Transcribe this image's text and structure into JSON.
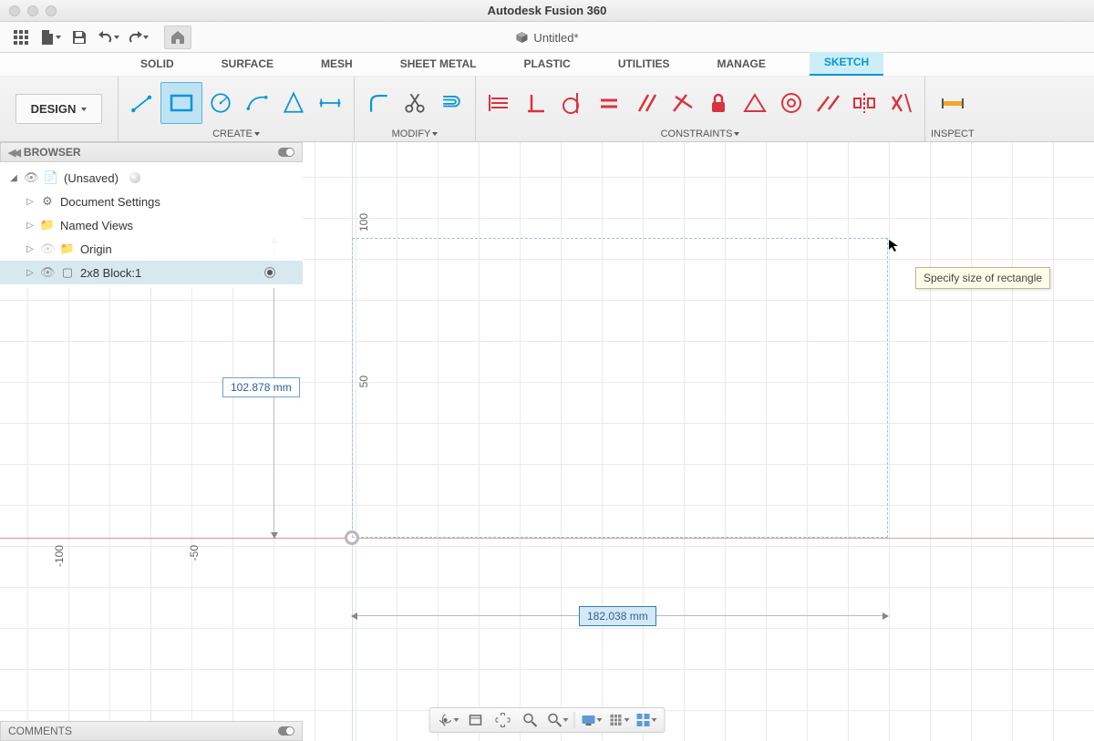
{
  "app": {
    "title": "Autodesk Fusion 360"
  },
  "document": {
    "name": "Untitled*"
  },
  "workspace": {
    "label": "DESIGN"
  },
  "tabs": [
    {
      "label": "SOLID"
    },
    {
      "label": "SURFACE"
    },
    {
      "label": "MESH"
    },
    {
      "label": "SHEET METAL"
    },
    {
      "label": "PLASTIC"
    },
    {
      "label": "UTILITIES"
    },
    {
      "label": "MANAGE"
    },
    {
      "label": "SKETCH",
      "active": true
    }
  ],
  "ribbon_groups": {
    "create": "CREATE",
    "modify": "MODIFY",
    "constraints": "CONSTRAINTS",
    "inspect": "INSPECT"
  },
  "browser": {
    "title": "BROWSER",
    "root": "(Unsaved)",
    "items": [
      {
        "label": "Document Settings"
      },
      {
        "label": "Named Views"
      },
      {
        "label": "Origin"
      },
      {
        "label": "2x8 Block:1",
        "selected": true
      }
    ]
  },
  "comments": {
    "title": "COMMENTS"
  },
  "sketch": {
    "dim_v": "102.878 mm",
    "dim_h": "182.038 mm",
    "tooltip": "Specify size of rectangle",
    "ruler_y1": "100",
    "ruler_y2": "50",
    "ruler_x1": "-100",
    "ruler_x2": "-50"
  }
}
